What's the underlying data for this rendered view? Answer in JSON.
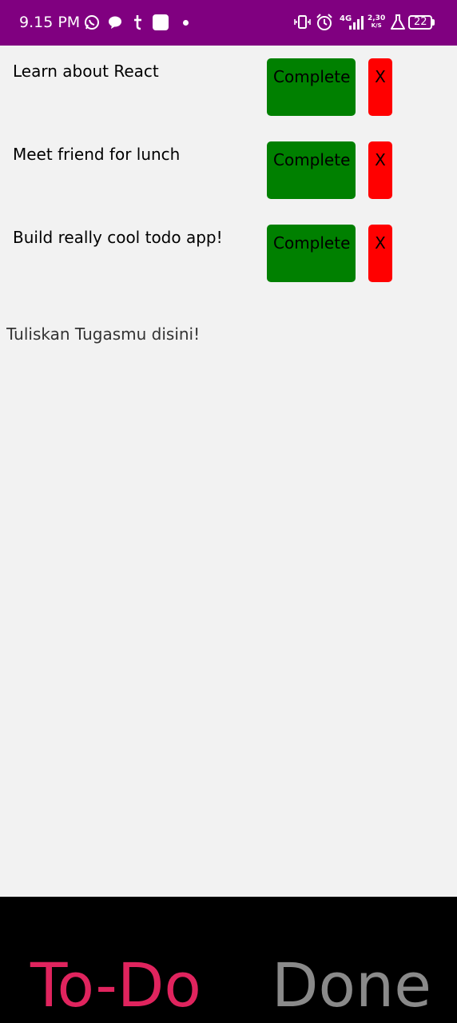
{
  "status_bar": {
    "time": "9.15 PM",
    "network": "4G",
    "speed_value": "2,30",
    "speed_unit": "K/S",
    "battery": "22",
    "background_color": "#800080",
    "left_icons": [
      "whatsapp-icon",
      "chat-bubble-icon",
      "tumblr-icon",
      "app-square-icon",
      "dot-icon"
    ],
    "right_icons": [
      "vibrate-icon",
      "alarm-icon",
      "signal-icon",
      "flask-icon",
      "battery-icon"
    ]
  },
  "todos": [
    {
      "text": "Learn about React",
      "complete_label": "Complete",
      "delete_label": "X"
    },
    {
      "text": "Meet friend for lunch",
      "complete_label": "Complete",
      "delete_label": "X"
    },
    {
      "text": "Build really cool todo app!",
      "complete_label": "Complete",
      "delete_label": "X"
    }
  ],
  "input": {
    "placeholder": "Tuliskan Tugasmu disini!",
    "value": ""
  },
  "bottom_nav": {
    "tabs": [
      {
        "label": "To-Do",
        "active": true
      },
      {
        "label": "Done",
        "active": false
      }
    ]
  },
  "colors": {
    "complete_button": "#008000",
    "delete_button": "#ff0000",
    "active_tab": "#e0245e",
    "inactive_tab": "#8a8a8a",
    "nav_background": "#000000",
    "page_background": "#f2f2f2"
  }
}
